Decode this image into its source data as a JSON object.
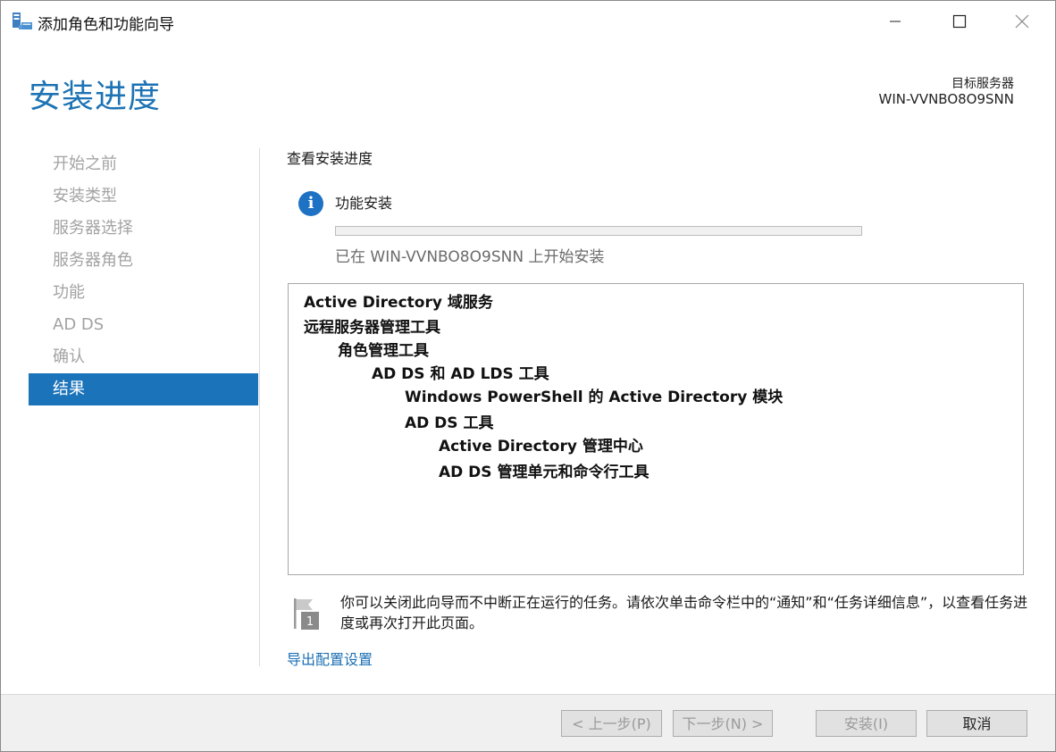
{
  "window": {
    "title": "添加角色和功能向导"
  },
  "header": {
    "page_title": "安装进度",
    "target_label": "目标服务器",
    "target_server": "WIN-VVNBO8O9SNN"
  },
  "nav": {
    "items": [
      {
        "label": "开始之前",
        "active": false
      },
      {
        "label": "安装类型",
        "active": false
      },
      {
        "label": "服务器选择",
        "active": false
      },
      {
        "label": "服务器角色",
        "active": false
      },
      {
        "label": "功能",
        "active": false
      },
      {
        "label": "AD DS",
        "active": false
      },
      {
        "label": "确认",
        "active": false
      },
      {
        "label": "结果",
        "active": true
      }
    ]
  },
  "content": {
    "section_title": "查看安装进度",
    "feature_label": "功能安装",
    "progress": 0.0,
    "status_text": "已在 WIN-VVNBO8O9SNN 上开始安装",
    "results": [
      {
        "text": "Active Directory 域服务",
        "level": 0
      },
      {
        "text": "远程服务器管理工具",
        "level": 0
      },
      {
        "text": "角色管理工具",
        "level": 1
      },
      {
        "text": "AD DS 和 AD LDS 工具",
        "level": 2
      },
      {
        "text": "Windows PowerShell 的 Active Directory 模块",
        "level": 3
      },
      {
        "text": "AD DS 工具",
        "level": 3
      },
      {
        "text": "Active Directory 管理中心",
        "level": 4
      },
      {
        "text": "AD DS 管理单元和命令行工具",
        "level": 4
      }
    ],
    "note_badge": "1",
    "note_text": "你可以关闭此向导而不中断正在运行的任务。请依次单击命令栏中的“通知”和“任务详细信息”，以查看任务进度或再次打开此页面。",
    "export_link": "导出配置设置"
  },
  "footer": {
    "prev_label": "< 上一步(P)",
    "next_label": "下一步(N) >",
    "install_label": "安装(I)",
    "cancel_label": "取消"
  },
  "colors": {
    "accent": "#1b73ba",
    "title": "#1e73b4",
    "link": "#1c6fb4"
  }
}
